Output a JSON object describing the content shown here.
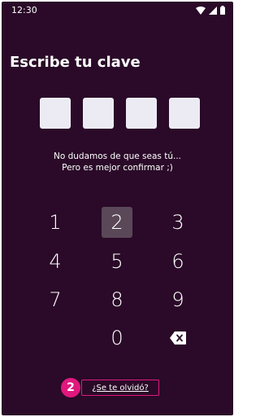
{
  "status_bar": {
    "time": "12:30",
    "icons": [
      "wifi-icon",
      "signal-icon",
      "battery-icon"
    ]
  },
  "header": {
    "title": "Escribe tu clave"
  },
  "pin": {
    "length": 4,
    "filled": 0
  },
  "message": {
    "line1": "No dudamos de que seas tú...",
    "line2": "Pero es mejor confirmar ;)"
  },
  "keypad": {
    "keys": [
      "1",
      "2",
      "3",
      "4",
      "5",
      "6",
      "7",
      "8",
      "9",
      "0"
    ],
    "pressed_key": "2",
    "backspace_icon": "backspace-icon"
  },
  "forgot": {
    "badge": "2",
    "label": "¿Se te olvidó?"
  },
  "colors": {
    "background": "#2a0a28",
    "pin_box": "#ecebf3",
    "accent": "#e0187e",
    "pressed_key": "#5a4858"
  }
}
